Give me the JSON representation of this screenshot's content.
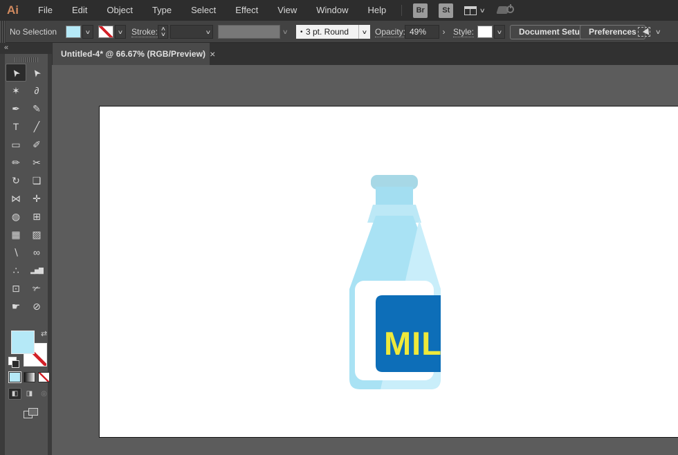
{
  "icons": {
    "chevron_down": "∨",
    "stepper_up": "∧",
    "stepper_down": "∨",
    "collapse": "«",
    "close": "×",
    "swap": "⇄",
    "bullet": "•",
    "arrow_right": "›"
  },
  "menu_bar": {
    "logo": "Ai",
    "items": [
      "File",
      "Edit",
      "Object",
      "Type",
      "Select",
      "Effect",
      "View",
      "Window",
      "Help"
    ],
    "bridge_label": "Br",
    "stock_label": "St"
  },
  "control_bar": {
    "selection_status": "No Selection",
    "stroke_label": "Stroke:",
    "brush_value": "3 pt. Round",
    "opacity_label": "Opacity:",
    "opacity_value": "49%",
    "style_label": "Style:",
    "document_setup_label": "Document Setup",
    "preferences_label": "Preferences"
  },
  "document_tab": {
    "title": "Untitled-4* @ 66.67% (RGB/Preview)"
  },
  "toolbar": {
    "tools": [
      {
        "name": "selection-tool",
        "glyph": "➤",
        "selected": true,
        "rot": true
      },
      {
        "name": "direct-selection-tool",
        "glyph": "➤",
        "rot": true
      },
      {
        "name": "magic-wand-tool",
        "glyph": "✶"
      },
      {
        "name": "lasso-tool",
        "glyph": "∂"
      },
      {
        "name": "pen-tool",
        "glyph": "✒"
      },
      {
        "name": "curvature-tool",
        "glyph": "✎"
      },
      {
        "name": "type-tool",
        "glyph": "T"
      },
      {
        "name": "line-segment-tool",
        "glyph": "╱"
      },
      {
        "name": "rectangle-tool",
        "glyph": "▭"
      },
      {
        "name": "paintbrush-tool",
        "glyph": "✐"
      },
      {
        "name": "shaper-tool",
        "glyph": "✏"
      },
      {
        "name": "scissors-tool",
        "glyph": "✂"
      },
      {
        "name": "rotate-tool",
        "glyph": "↻"
      },
      {
        "name": "scale-tool",
        "glyph": "❏"
      },
      {
        "name": "width-tool",
        "glyph": "⋈"
      },
      {
        "name": "puppet-warp-tool",
        "glyph": "✛"
      },
      {
        "name": "shape-builder-tool",
        "glyph": "◍"
      },
      {
        "name": "perspective-grid-tool",
        "glyph": "⊞"
      },
      {
        "name": "mesh-tool",
        "glyph": "▦"
      },
      {
        "name": "gradient-tool",
        "glyph": "▨"
      },
      {
        "name": "eyedropper-tool",
        "glyph": "∖"
      },
      {
        "name": "blend-tool",
        "glyph": "∞"
      },
      {
        "name": "symbol-sprayer-tool",
        "glyph": "∴"
      },
      {
        "name": "column-graph-tool",
        "glyph": "▂▅▇",
        "small": true
      },
      {
        "name": "artboard-tool",
        "glyph": "⊡"
      },
      {
        "name": "slice-tool",
        "glyph": "✃"
      },
      {
        "name": "hand-tool",
        "glyph": "☛"
      },
      {
        "name": "zoom-tool",
        "glyph": "⊘"
      }
    ]
  },
  "canvas": {
    "milk_text": "MILK"
  },
  "colors": {
    "fill_swatch": "#b5e9f7",
    "bottle_body": "#a9e2f4",
    "bottle_highlight": "#c9eefa",
    "bottle_cap": "#a7d8e6",
    "bottle_neck": "#a3def1",
    "bottle_flare": "#bce8f6",
    "label_bg": "#ffffff",
    "label_square": "#0d6eb8",
    "milk_text": "#eee93b",
    "stroke_none_red": "#d22128",
    "logo_orange": "#d18a5f",
    "pasteboard": "#5c5c5c"
  }
}
